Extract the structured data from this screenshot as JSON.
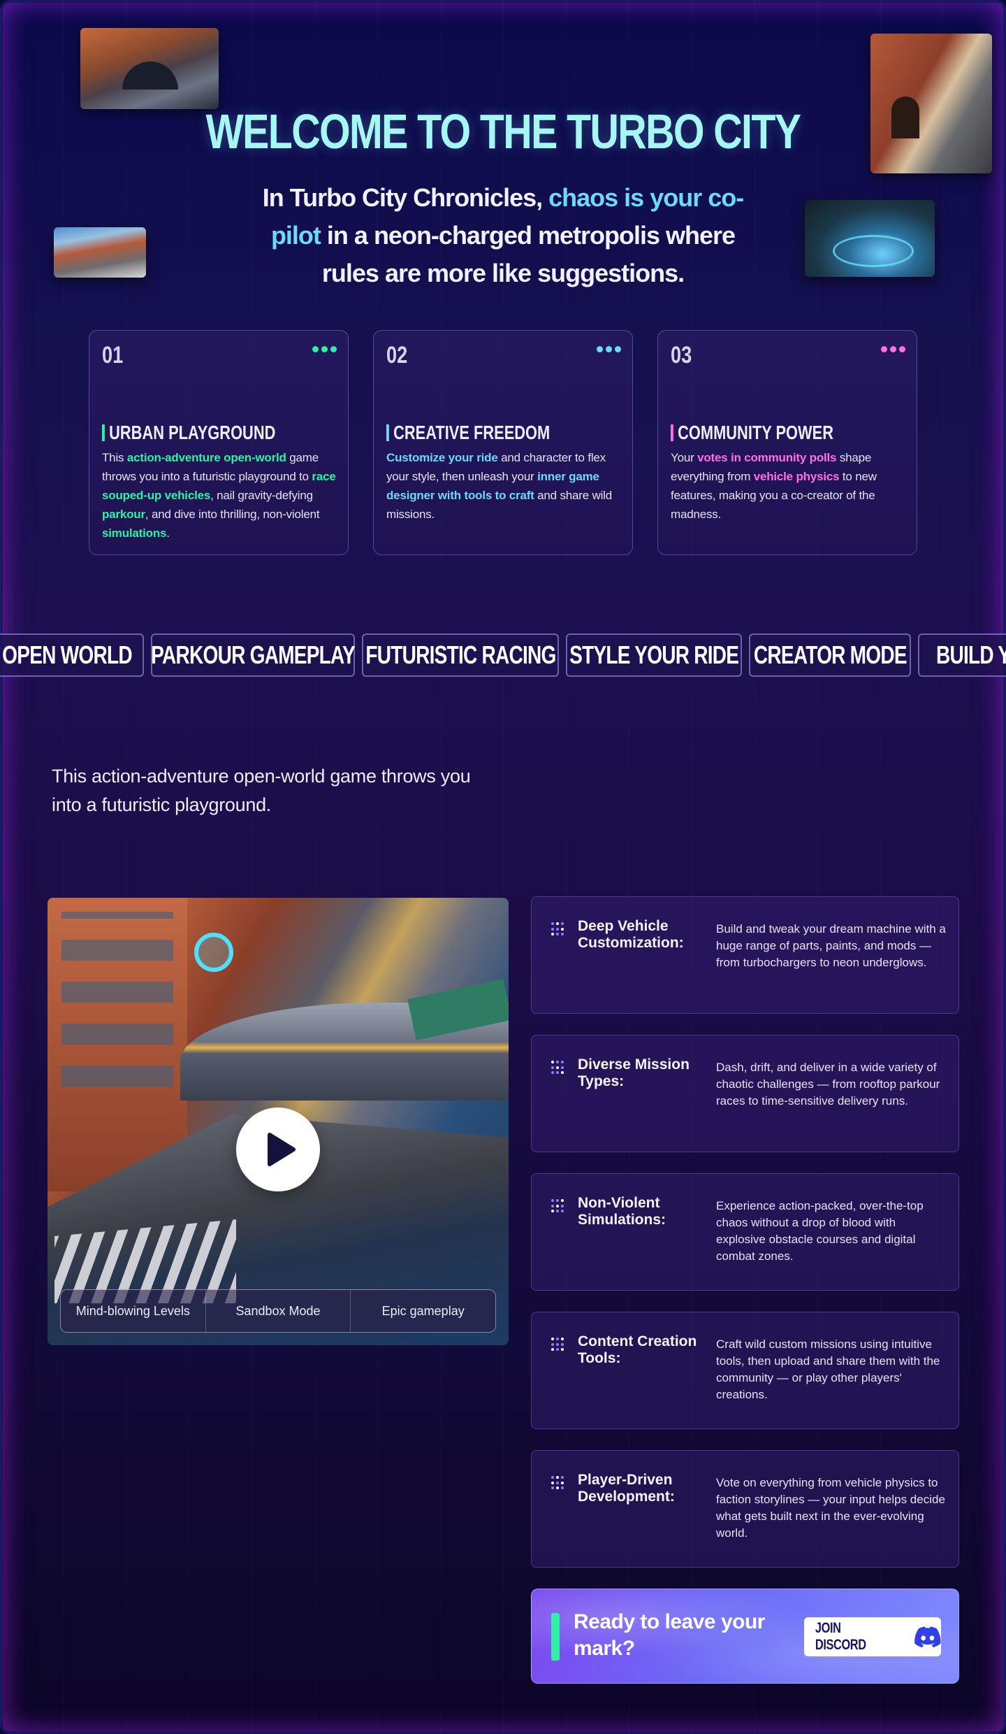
{
  "hero": {
    "title": "WELCOME TO THE TURBO CITY",
    "subtitle_pre": "In Turbo City Chronicles, ",
    "subtitle_highlight": "chaos is your co-pilot",
    "subtitle_post": " in a neon-charged metropolis where rules are more like suggestions."
  },
  "cards": [
    {
      "num": "01",
      "title": "URBAN PLAYGROUND",
      "accent": "#2ff0a3",
      "parts": [
        {
          "t": "This ",
          "h": ""
        },
        {
          "t": "action-adventure open-world",
          "h": "g"
        },
        {
          "t": " game throws you into a futuristic playground to ",
          "h": ""
        },
        {
          "t": "race souped-up vehicles",
          "h": "g"
        },
        {
          "t": ", nail gravity-defying ",
          "h": ""
        },
        {
          "t": "parkour",
          "h": "g"
        },
        {
          "t": ", and dive into thrilling, non-violent ",
          "h": ""
        },
        {
          "t": "simulations",
          "h": "g"
        },
        {
          "t": ".",
          "h": ""
        }
      ]
    },
    {
      "num": "02",
      "title": "CREATIVE FREEDOM",
      "accent": "#6fd8f5",
      "parts": [
        {
          "t": "Customize your ride",
          "h": "c"
        },
        {
          "t": " and character to flex your style, then unleash your ",
          "h": ""
        },
        {
          "t": "inner game designer with tools to craft",
          "h": "c"
        },
        {
          "t": " and share wild missions.",
          "h": ""
        }
      ]
    },
    {
      "num": "03",
      "title": "COMMUNITY POWER",
      "accent": "#ff6fe0",
      "parts": [
        {
          "t": "Your ",
          "h": ""
        },
        {
          "t": "votes in community polls",
          "h": "p"
        },
        {
          "t": " shape everything from ",
          "h": ""
        },
        {
          "t": "vehicle physics",
          "h": "p"
        },
        {
          "t": " to new features, making you a co-creator of the madness.",
          "h": ""
        }
      ]
    }
  ],
  "marquee": [
    "OPEN WORLD",
    "PARKOUR GAMEPLAY",
    "FUTURISTIC RACING",
    "STYLE YOUR RIDE",
    "CREATOR MODE",
    "BUILD YO"
  ],
  "intro": "This action-adventure open-world game throws you into a futuristic playground.",
  "video": {
    "tabs": [
      "Mind-blowing Levels",
      "Sandbox Mode",
      "Epic gameplay"
    ],
    "play_icon": "play-icon"
  },
  "features": [
    {
      "name": "Deep Vehicle Customization:",
      "desc": "Build and tweak your dream machine with a huge range of parts, paints, and mods — from turbochargers to neon underglows."
    },
    {
      "name": "Diverse Mission Types:",
      "desc": "Dash, drift, and deliver in a wide variety of chaotic challenges — from rooftop parkour races to time-sensitive delivery runs."
    },
    {
      "name": "Non-Violent Simulations:",
      "desc": "Experience action-packed, over-the-top chaos without a drop of blood with explosive obstacle courses and digital combat zones."
    },
    {
      "name": "Content Creation Tools:",
      "desc": "Craft wild custom missions using intuitive tools, then upload and share them with the community — or play other players' creations."
    },
    {
      "name": "Player-Driven Development:",
      "desc": "Vote on everything from vehicle physics to faction storylines — your input helps decide what gets built next in the ever-evolving world."
    }
  ],
  "cta": {
    "text": "Ready to leave your mark?",
    "button": "JOIN DISCORD",
    "icon": "discord-icon"
  },
  "colors": {
    "accent_green": "#2ff0a3",
    "accent_cyan": "#6fd8f5",
    "accent_pink": "#ff6fe0",
    "title_cyan": "#a6f6f4",
    "background": "#120c46"
  }
}
